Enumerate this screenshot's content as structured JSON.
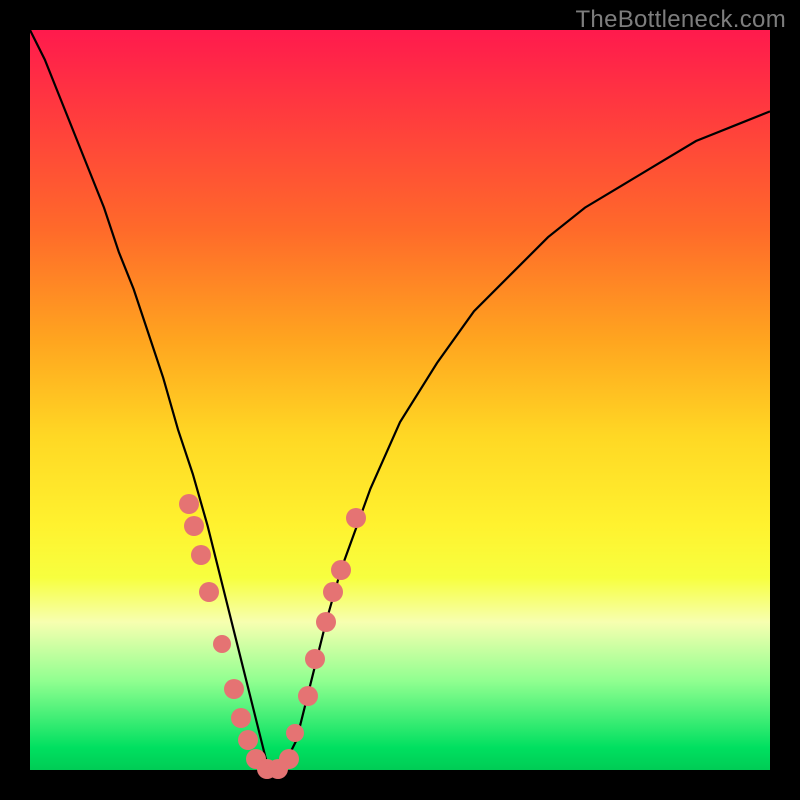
{
  "watermark": "TheBottleneck.com",
  "colors": {
    "gradient_top": "#ff1a4d",
    "gradient_mid": "#ffd824",
    "gradient_bottom": "#00cc55",
    "curve": "#000000",
    "dot": "#e57373",
    "frame": "#000000"
  },
  "chart_data": {
    "type": "line",
    "title": "",
    "xlabel": "",
    "ylabel": "",
    "xlim": [
      0,
      100
    ],
    "ylim": [
      0,
      100
    ],
    "x": [
      0,
      2,
      4,
      6,
      8,
      10,
      12,
      14,
      16,
      18,
      20,
      22,
      24,
      26,
      28,
      30,
      32,
      34,
      36,
      38,
      40,
      42,
      46,
      50,
      55,
      60,
      65,
      70,
      75,
      80,
      85,
      90,
      95,
      100
    ],
    "values": [
      100,
      96,
      91,
      86,
      81,
      76,
      70,
      65,
      59,
      53,
      46,
      40,
      33,
      25,
      17,
      9,
      1,
      0,
      4,
      12,
      20,
      27,
      38,
      47,
      55,
      62,
      67,
      72,
      76,
      79,
      82,
      85,
      87,
      89
    ],
    "dots": [
      {
        "x": 21.5,
        "y": 36,
        "r": 10
      },
      {
        "x": 22.2,
        "y": 33,
        "r": 10
      },
      {
        "x": 23.1,
        "y": 29,
        "r": 10
      },
      {
        "x": 24.2,
        "y": 24,
        "r": 10
      },
      {
        "x": 26.0,
        "y": 17,
        "r": 9
      },
      {
        "x": 27.5,
        "y": 11,
        "r": 10
      },
      {
        "x": 28.5,
        "y": 7,
        "r": 10
      },
      {
        "x": 29.5,
        "y": 4,
        "r": 10
      },
      {
        "x": 30.5,
        "y": 1.5,
        "r": 10
      },
      {
        "x": 32.0,
        "y": 0.2,
        "r": 10
      },
      {
        "x": 33.5,
        "y": 0.2,
        "r": 10
      },
      {
        "x": 35.0,
        "y": 1.5,
        "r": 10
      },
      {
        "x": 35.8,
        "y": 5,
        "r": 9
      },
      {
        "x": 37.5,
        "y": 10,
        "r": 10
      },
      {
        "x": 38.5,
        "y": 15,
        "r": 10
      },
      {
        "x": 40.0,
        "y": 20,
        "r": 10
      },
      {
        "x": 41.0,
        "y": 24,
        "r": 10
      },
      {
        "x": 42.0,
        "y": 27,
        "r": 10
      },
      {
        "x": 44.0,
        "y": 34,
        "r": 10
      }
    ]
  }
}
